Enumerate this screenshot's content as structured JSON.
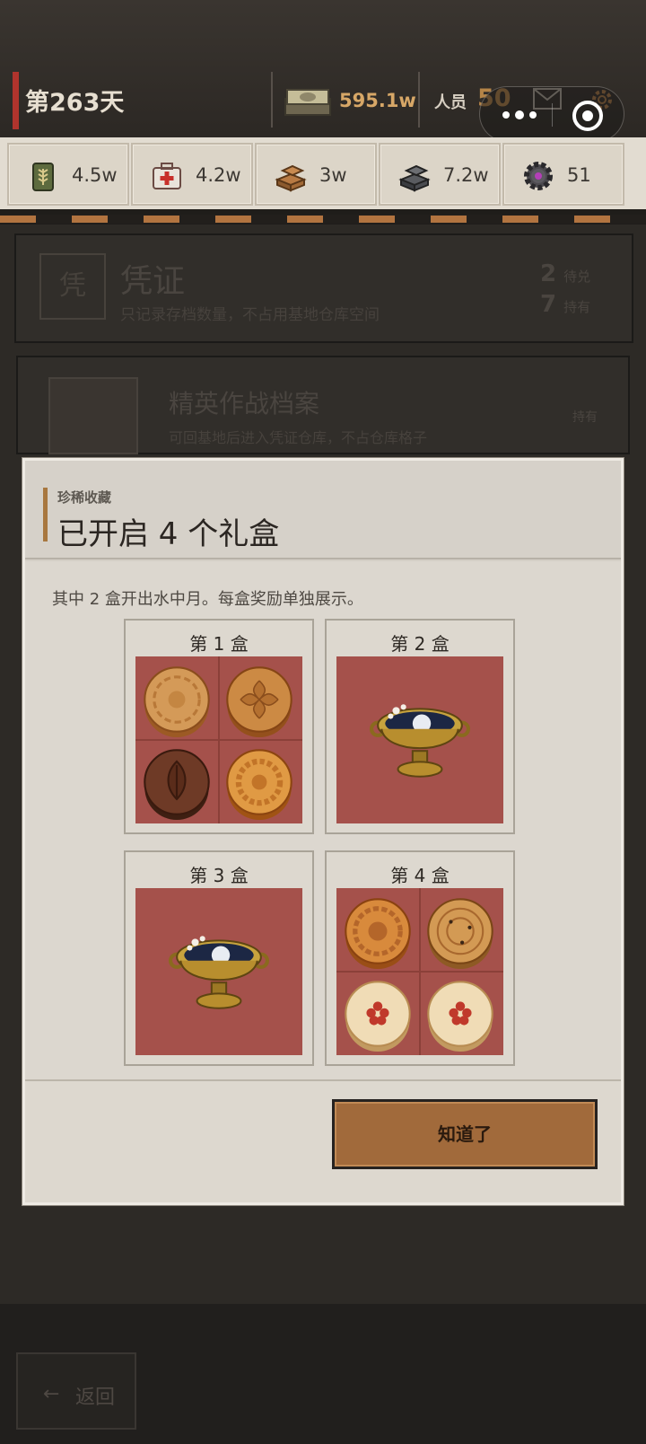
{
  "header": {
    "day": "第263天",
    "cash": "595.1w",
    "staff_label": "人员",
    "staff_count": "50"
  },
  "resources": [
    {
      "icon": "wheat-can-icon",
      "value": "4.5w"
    },
    {
      "icon": "medkit-icon",
      "value": "4.2w"
    },
    {
      "icon": "wood-planks-icon",
      "value": "3w"
    },
    {
      "icon": "steel-ingot-icon",
      "value": "7.2w"
    },
    {
      "icon": "gear-part-icon",
      "value": "51"
    }
  ],
  "background": {
    "card1": {
      "stamp": "凭",
      "title": "凭证",
      "description": "只记录存档数量，不占用基地仓库空间",
      "stat1_value": "2",
      "stat1_label": "待兑",
      "stat2_value": "7",
      "stat2_label": "持有"
    },
    "card2": {
      "title": "精英作战档案",
      "description": "可回基地后进入凭证仓库，不占仓库格子",
      "meta": "持有"
    },
    "back_label": "返回"
  },
  "modal": {
    "subtitle": "珍稀收藏",
    "title": "已开启 4 个礼盒",
    "note": "其中 2 盒开出水中月。每盒奖励单独展示。",
    "boxes": [
      {
        "label": "第 1 盒",
        "contents": [
          "mooncake",
          "mooncake",
          "mooncake",
          "mooncake"
        ]
      },
      {
        "label": "第 2 盒",
        "contents": [
          "水中月"
        ]
      },
      {
        "label": "第 3 盒",
        "contents": [
          "水中月"
        ]
      },
      {
        "label": "第 4 盒",
        "contents": [
          "mooncake",
          "mooncake",
          "mooncake",
          "mooncake"
        ]
      }
    ],
    "confirm_label": "知道了"
  },
  "colors": {
    "accent_red": "#b0342d",
    "cash_gold": "#d7a767",
    "box_background": "#a5514b",
    "button": "#a16a3b"
  }
}
